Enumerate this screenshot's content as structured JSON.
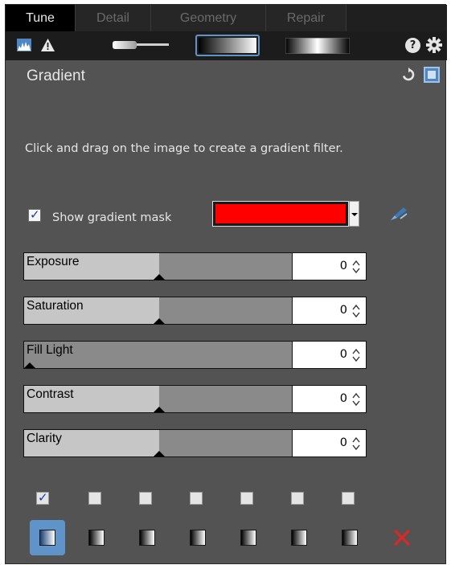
{
  "tabs": [
    {
      "label": "Tune",
      "active": true
    },
    {
      "label": "Detail",
      "active": false
    },
    {
      "label": "Geometry",
      "active": false
    },
    {
      "label": "Repair",
      "active": false
    }
  ],
  "toolbar": {
    "icons": [
      "histogram-icon",
      "warning-icon",
      "brush-tool-icon",
      "gradient-tool-icon",
      "radial-gradient-tool-icon",
      "help-icon",
      "settings-icon"
    ],
    "help_glyph": "?"
  },
  "header": {
    "title": "Gradient",
    "icons": [
      "reset-icon",
      "toggle-icon"
    ]
  },
  "instructions": "Click and drag on the image to create a gradient filter.",
  "mask": {
    "label": "Show gradient mask",
    "checked": true,
    "color": "#ff0000",
    "color_icon": "mask-picker-icon"
  },
  "sliders": [
    {
      "label": "Exposure",
      "value": "0",
      "position": 0.5
    },
    {
      "label": "Saturation",
      "value": "0",
      "position": 0.5
    },
    {
      "label": "Fill Light",
      "value": "0",
      "position": 0.0
    },
    {
      "label": "Contrast",
      "value": "0",
      "position": 0.5
    },
    {
      "label": "Clarity",
      "value": "0",
      "position": 0.5
    }
  ],
  "filters": {
    "checkboxes": [
      true,
      false,
      false,
      false,
      false,
      false,
      false
    ],
    "selected_index": 0,
    "delete_icon": "delete-icon"
  },
  "colors": {
    "accent": "#5e94c9",
    "delete": "#d42a2a",
    "mask": "#ff0000"
  }
}
